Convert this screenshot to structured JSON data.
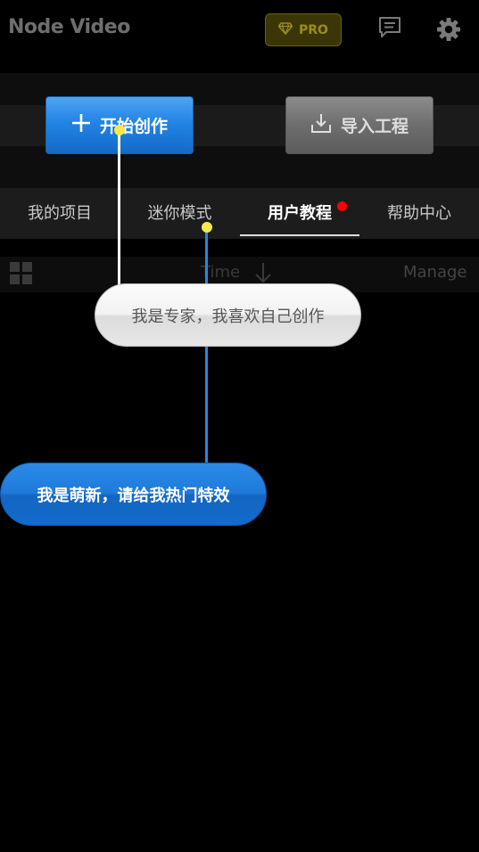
{
  "header": {
    "title": "Node Video",
    "pro_label": "PRO",
    "icons": [
      "diamond-icon",
      "message-icon",
      "gear-icon"
    ]
  },
  "actions": {
    "create_label": "开始创作",
    "import_label": "导入工程"
  },
  "tabs": [
    {
      "label": "我的项目",
      "active": false
    },
    {
      "label": "迷你模式",
      "active": false
    },
    {
      "label": "用户教程",
      "active": true,
      "badge": true
    },
    {
      "label": "帮助中心",
      "active": false
    }
  ],
  "sortbar": {
    "sort_label": "Time",
    "manage_label": "Manage"
  },
  "guide": {
    "expert_label": "我是专家，我喜欢自己创作",
    "newbie_label": "我是萌新，请给我热门特效"
  },
  "colors": {
    "accent_blue": "#1f7ad9",
    "pro_gold": "#9a8d1c",
    "badge_red": "#ff0000",
    "pointer_yellow": "#f7e94a"
  }
}
